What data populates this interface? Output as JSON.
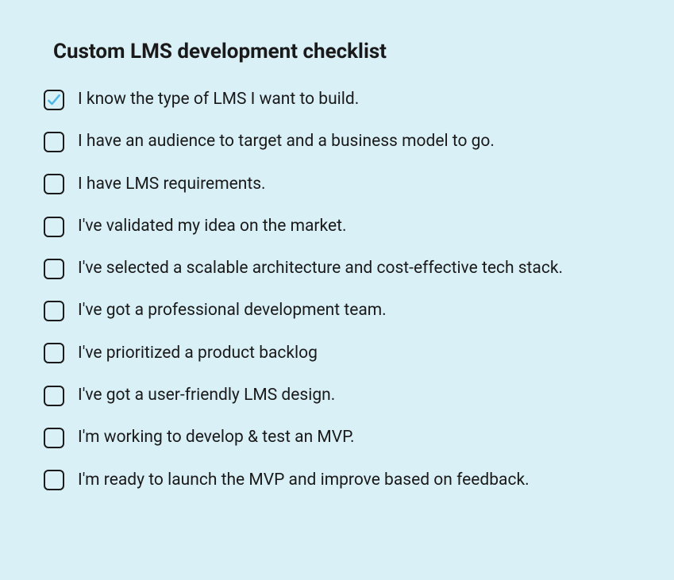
{
  "title": "Custom LMS development checklist",
  "items": [
    {
      "label": "I know the type of LMS I want to build.",
      "checked": true
    },
    {
      "label": "I have an audience to target and a business model to go.",
      "checked": false
    },
    {
      "label": "I have LMS requirements.",
      "checked": false
    },
    {
      "label": "I've validated my idea on the market.",
      "checked": false
    },
    {
      "label": "I've selected a scalable architecture and cost-effective tech stack.",
      "checked": false
    },
    {
      "label": "I've got a professional development team.",
      "checked": false
    },
    {
      "label": "I've prioritized a product backlog",
      "checked": false
    },
    {
      "label": "I've got a user-friendly LMS design.",
      "checked": false
    },
    {
      "label": "I'm working to develop & test an MVP.",
      "checked": false
    },
    {
      "label": "I'm ready to launch the MVP and improve based on feedback.",
      "checked": false
    }
  ],
  "colors": {
    "background": "#d9f0f7",
    "text": "#1a1a1a",
    "checkmark": "#4db8e8"
  }
}
